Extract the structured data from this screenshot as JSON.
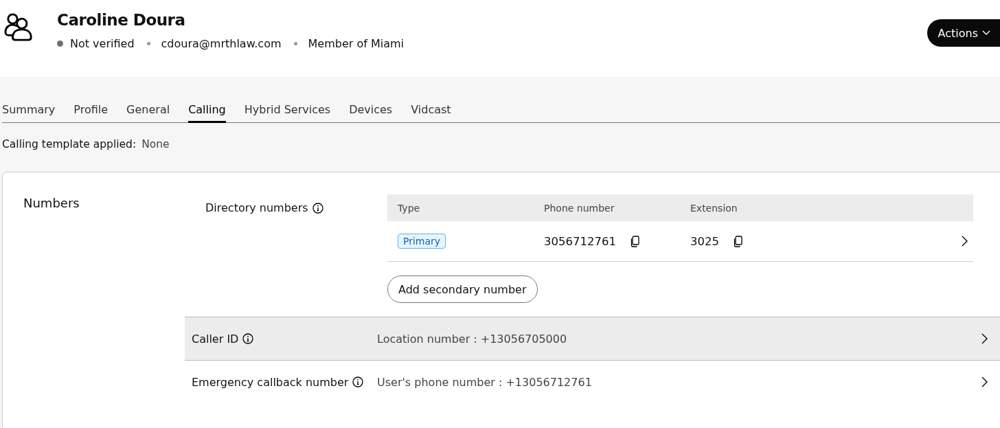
{
  "header": {
    "name": "Caroline Doura",
    "meta": [
      {
        "kind": "status",
        "text": "Not verified"
      },
      {
        "kind": "text",
        "text": "cdoura@mrthlaw.com"
      },
      {
        "kind": "text",
        "text": "Member of Miami"
      }
    ],
    "actions_button": "Actions"
  },
  "tabs": [
    {
      "label": "Summary",
      "selected": false
    },
    {
      "label": "Profile",
      "selected": false
    },
    {
      "label": "General",
      "selected": false
    },
    {
      "label": "Calling",
      "selected": true
    },
    {
      "label": "Hybrid Services",
      "selected": false
    },
    {
      "label": "Devices",
      "selected": false
    },
    {
      "label": "Vidcast",
      "selected": false
    }
  ],
  "template": {
    "label": "Calling template applied:",
    "value": "None"
  },
  "section": {
    "title": "Numbers",
    "directory_numbers": {
      "label": "Directory numbers",
      "columns": [
        "Type",
        "Phone number",
        "Extension"
      ],
      "rows": [
        {
          "type": "Primary",
          "phone": "3056712761",
          "extension": "3025"
        }
      ],
      "add_button": "Add secondary number"
    },
    "settings_rows": [
      {
        "label": "Caller ID",
        "value": "Location number : +13056705000",
        "highlighted": true
      },
      {
        "label": "Emergency callback number",
        "value": "User's phone number : +13056712761",
        "highlighted": false
      }
    ]
  }
}
